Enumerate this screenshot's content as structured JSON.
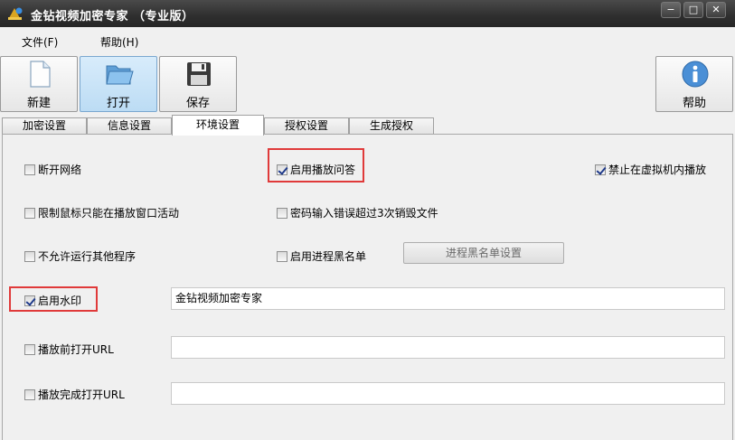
{
  "window": {
    "title": "金钻视频加密专家 （专业版）",
    "minimize_glyph": "−",
    "maximize_glyph": "□",
    "close_glyph": "✕"
  },
  "menu": [
    "文件(F)",
    "帮助(H)"
  ],
  "toolbar": {
    "new_label": "新建",
    "open_label": "打开",
    "save_label": "保存",
    "help_label": "帮助"
  },
  "tabs": [
    "加密设置",
    "信息设置",
    "环境设置",
    "授权设置",
    "生成授权"
  ],
  "active_tab": "环境设置",
  "options": {
    "disconnect_network": {
      "label": "断开网络",
      "checked": false
    },
    "enable_play_qa": {
      "label": "启用播放问答",
      "checked": true
    },
    "block_vm_playback": {
      "label": "禁止在虚拟机内播放",
      "checked": true
    },
    "restrict_mouse": {
      "label": "限制鼠标只能在播放窗口活动",
      "checked": false
    },
    "destroy_after_wrong_pw": {
      "label": "密码输入错误超过3次销毁文件",
      "checked": false
    },
    "disallow_other_programs": {
      "label": "不允许运行其他程序",
      "checked": false
    },
    "enable_process_blacklist": {
      "label": "启用进程黑名单",
      "checked": false
    },
    "enable_watermark": {
      "label": "启用水印",
      "checked": true
    },
    "open_url_before_play": {
      "label": "播放前打开URL",
      "checked": false
    },
    "open_url_after_play": {
      "label": "播放完成打开URL",
      "checked": false
    }
  },
  "blacklist_button": "进程黑名单设置",
  "fields": {
    "watermark_text": "金钻视频加密专家",
    "before_url": "",
    "after_url": ""
  },
  "colors": {
    "highlight": "#e03a3a",
    "titlebar": "#2e2e2e",
    "active_toolbar": "#bcdcf4"
  }
}
